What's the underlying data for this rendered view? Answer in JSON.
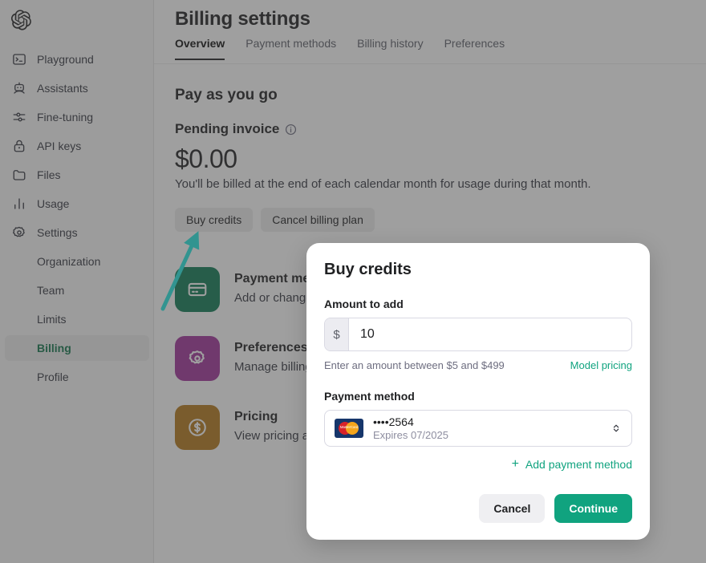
{
  "sidebar": {
    "logo": "openai-logo",
    "items": [
      {
        "label": "Playground",
        "icon": "terminal-icon"
      },
      {
        "label": "Assistants",
        "icon": "robot-icon"
      },
      {
        "label": "Fine-tuning",
        "icon": "sliders-icon"
      },
      {
        "label": "API keys",
        "icon": "lock-icon"
      },
      {
        "label": "Files",
        "icon": "folder-icon"
      },
      {
        "label": "Usage",
        "icon": "bar-chart-icon"
      },
      {
        "label": "Settings",
        "icon": "gear-icon"
      }
    ],
    "sub_items": [
      {
        "label": "Organization",
        "active": false
      },
      {
        "label": "Team",
        "active": false
      },
      {
        "label": "Limits",
        "active": false
      },
      {
        "label": "Billing",
        "active": true
      },
      {
        "label": "Profile",
        "active": false
      }
    ],
    "active_color": "#10744b"
  },
  "header": {
    "title": "Billing settings",
    "tabs": [
      {
        "label": "Overview",
        "active": true
      },
      {
        "label": "Payment methods",
        "active": false
      },
      {
        "label": "Billing history",
        "active": false
      },
      {
        "label": "Preferences",
        "active": false
      }
    ]
  },
  "main": {
    "section_title": "Pay as you go",
    "pending_label": "Pending invoice",
    "pending_info_icon": "info-icon",
    "amount": "$0.00",
    "billing_note": "You'll be billed at the end of each calendar month for usage during that month.",
    "buttons": {
      "buy_credits": "Buy credits",
      "cancel_plan": "Cancel billing plan"
    },
    "cards": [
      {
        "title": "Payment methods",
        "desc": "Add or change payment methods and view invoices",
        "icon": "credit-card-icon",
        "color": "#0e7a55"
      },
      {
        "title": "Preferences",
        "desc": "Manage billing information and tax details",
        "icon": "gear-icon",
        "color": "#a0329b"
      },
      {
        "title": "Pricing",
        "desc": "View pricing and FAQs",
        "icon": "dollar-coin-icon",
        "color": "#b4781a"
      }
    ]
  },
  "modal": {
    "title": "Buy credits",
    "amount_label": "Amount to add",
    "currency_prefix": "$",
    "amount_value": "10",
    "amount_placeholder": "",
    "helper_text": "Enter an amount between $5 and $499",
    "model_pricing_link": "Model pricing",
    "payment_method_label": "Payment method",
    "payment_method": {
      "brand_icon": "mastercard-icon",
      "brand_word": "MasterCard",
      "number": "••••2564",
      "expiry": "Expires 07/2025",
      "stepper_icon": "chevron-up-down-icon"
    },
    "add_payment_method": "Add payment method",
    "add_icon": "plus-icon",
    "cancel_label": "Cancel",
    "continue_label": "Continue",
    "accent_color": "#10a37f"
  },
  "annotation": {
    "arrow_color": "#25e8e0",
    "points_to": "Buy credits"
  }
}
